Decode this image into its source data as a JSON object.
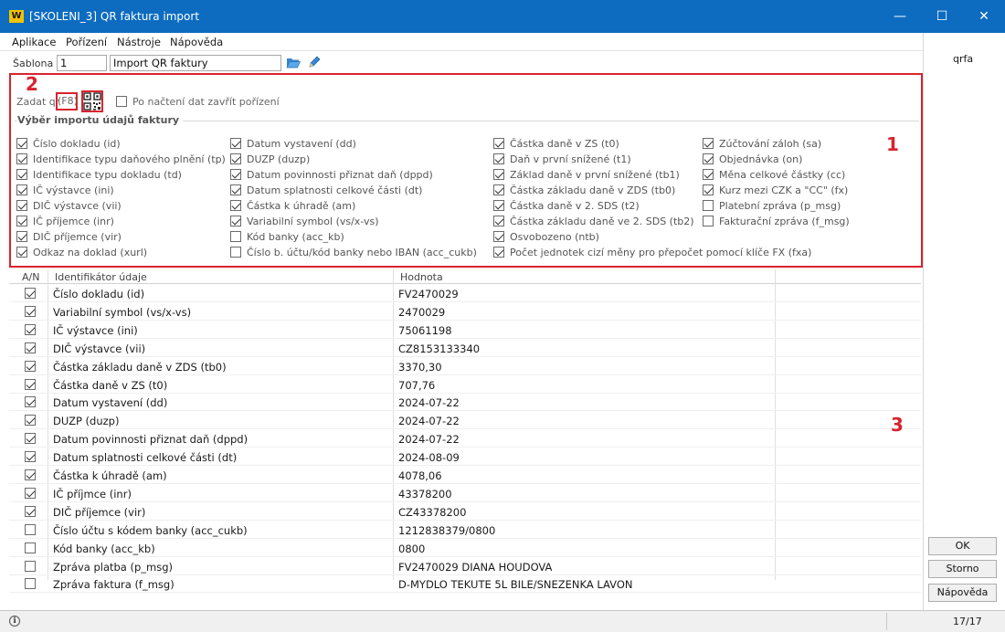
{
  "window": {
    "title": "[SKOLENI_3] QR faktura import",
    "app_icon": "W",
    "minimize": "—",
    "maximize": "☐",
    "close": "✕"
  },
  "menu": [
    "Aplikace",
    "Pořízení",
    "Nástroje",
    "Nápověda"
  ],
  "sablona": {
    "label": "Šablona :",
    "number": "1",
    "name": "Import QR faktury"
  },
  "right_panel": {
    "code": "qrfa",
    "ok": "OK",
    "storno": "Storno",
    "napoveda": "Nápověda"
  },
  "qr_section": {
    "zadat_label": "Zadat qr",
    "f8_label": "(F8)",
    "close_after_label": "Po načtení dat zavřít pořízení",
    "close_after_checked": false,
    "group_title": "Výběr importu údajů faktury",
    "columns": [
      [
        {
          "label": "Číslo dokladu (id)",
          "checked": true
        },
        {
          "label": "Identifikace typu daňového plnění (tp)",
          "checked": true
        },
        {
          "label": "Identifikace typu dokladu (td)",
          "checked": true
        },
        {
          "label": "IČ výstavce (ini)",
          "checked": true
        },
        {
          "label": "DIČ výstavce (vii)",
          "checked": true
        },
        {
          "label": "IČ příjemce (inr)",
          "checked": true
        },
        {
          "label": "DIČ příjemce (vir)",
          "checked": true
        },
        {
          "label": "Odkaz na doklad (xurl)",
          "checked": true
        }
      ],
      [
        {
          "label": "Datum vystavení (dd)",
          "checked": true
        },
        {
          "label": "DUZP (duzp)",
          "checked": true
        },
        {
          "label": "Datum povinnosti přiznat daň (dppd)",
          "checked": true
        },
        {
          "label": "Datum splatnosti celkové části (dt)",
          "checked": true
        },
        {
          "label": "Částka k úhradě (am)",
          "checked": true
        },
        {
          "label": "Variabilní symbol (vs/x-vs)",
          "checked": true
        },
        {
          "label": "Kód banky (acc_kb)",
          "checked": false
        },
        {
          "label": "Číslo b. účtu/kód banky nebo IBAN (acc_cukb)",
          "checked": false
        }
      ],
      [
        {
          "label": "Částka daně v ZS (t0)",
          "checked": true
        },
        {
          "label": "Daň v první snížené (t1)",
          "checked": true
        },
        {
          "label": "Základ daně v první snížené (tb1)",
          "checked": true
        },
        {
          "label": "Částka základu daně v ZDS (tb0)",
          "checked": true
        },
        {
          "label": "Částka daně v 2. SDS (t2)",
          "checked": true
        },
        {
          "label": "Částka základu daně ve 2. SDS (tb2)",
          "checked": true
        },
        {
          "label": "Osvobozeno (ntb)",
          "checked": true
        },
        {
          "label": "Počet jednotek cizí měny pro přepočet pomocí klíče FX (fxa)",
          "checked": true
        }
      ],
      [
        {
          "label": "Zúčtování záloh (sa)",
          "checked": true
        },
        {
          "label": "Objednávka (on)",
          "checked": true
        },
        {
          "label": "Měna celkové částky (cc)",
          "checked": true
        },
        {
          "label": "Kurz mezi CZK a \"CC\" (fx)",
          "checked": true
        },
        {
          "label": "Platební zpráva (p_msg)",
          "checked": false
        },
        {
          "label": "Fakturační zpráva (f_msg)",
          "checked": false
        }
      ]
    ]
  },
  "annotations": {
    "n1": "1",
    "n2": "2",
    "n3": "3"
  },
  "grid": {
    "headers": {
      "an": "A/N",
      "id": "Identifikátor údaje",
      "value": "Hodnota"
    },
    "rows": [
      {
        "checked": true,
        "id": "Číslo dokladu (id)",
        "value": "FV2470029"
      },
      {
        "checked": true,
        "id": "Variabilní symbol (vs/x-vs)",
        "value": "2470029"
      },
      {
        "checked": true,
        "id": "IČ výstavce (ini)",
        "value": "75061198"
      },
      {
        "checked": true,
        "id": "DIČ výstavce (vii)",
        "value": "CZ8153133340"
      },
      {
        "checked": true,
        "id": "Částka základu daně v ZDS (tb0)",
        "value": "3370,30"
      },
      {
        "checked": true,
        "id": "Částka daně v ZS (t0)",
        "value": "707,76"
      },
      {
        "checked": true,
        "id": "Datum vystavení (dd)",
        "value": "2024-07-22"
      },
      {
        "checked": true,
        "id": "DUZP (duzp)",
        "value": "2024-07-22"
      },
      {
        "checked": true,
        "id": "Datum povinnosti přiznat daň (dppd)",
        "value": "2024-07-22"
      },
      {
        "checked": true,
        "id": "Datum splatnosti celkové části (dt)",
        "value": "2024-08-09"
      },
      {
        "checked": true,
        "id": "Částka k úhradě (am)",
        "value": "4078,06"
      },
      {
        "checked": true,
        "id": "IČ příjmce (inr)",
        "value": "43378200"
      },
      {
        "checked": true,
        "id": "DIČ příjemce (vir)",
        "value": "CZ43378200"
      },
      {
        "checked": false,
        "id": "Číslo účtu s kódem banky (acc_cukb)",
        "value": "1212838379/0800"
      },
      {
        "checked": false,
        "id": "Kód banky (acc_kb)",
        "value": "0800"
      },
      {
        "checked": false,
        "id": "Zpráva platba (p_msg)",
        "value": "FV2470029 DIANA HOUDOVA"
      },
      {
        "checked": false,
        "id": "Zpráva faktura (f_msg)",
        "value": "D-MYDLO TEKUTE 5L BILE/SNEZENKA LAVON"
      }
    ]
  },
  "status": {
    "count": "17/17"
  },
  "colors": {
    "titlebar": "#0d6cc0",
    "annotation_red": "#d9232e",
    "app_icon": "#f2c200"
  }
}
